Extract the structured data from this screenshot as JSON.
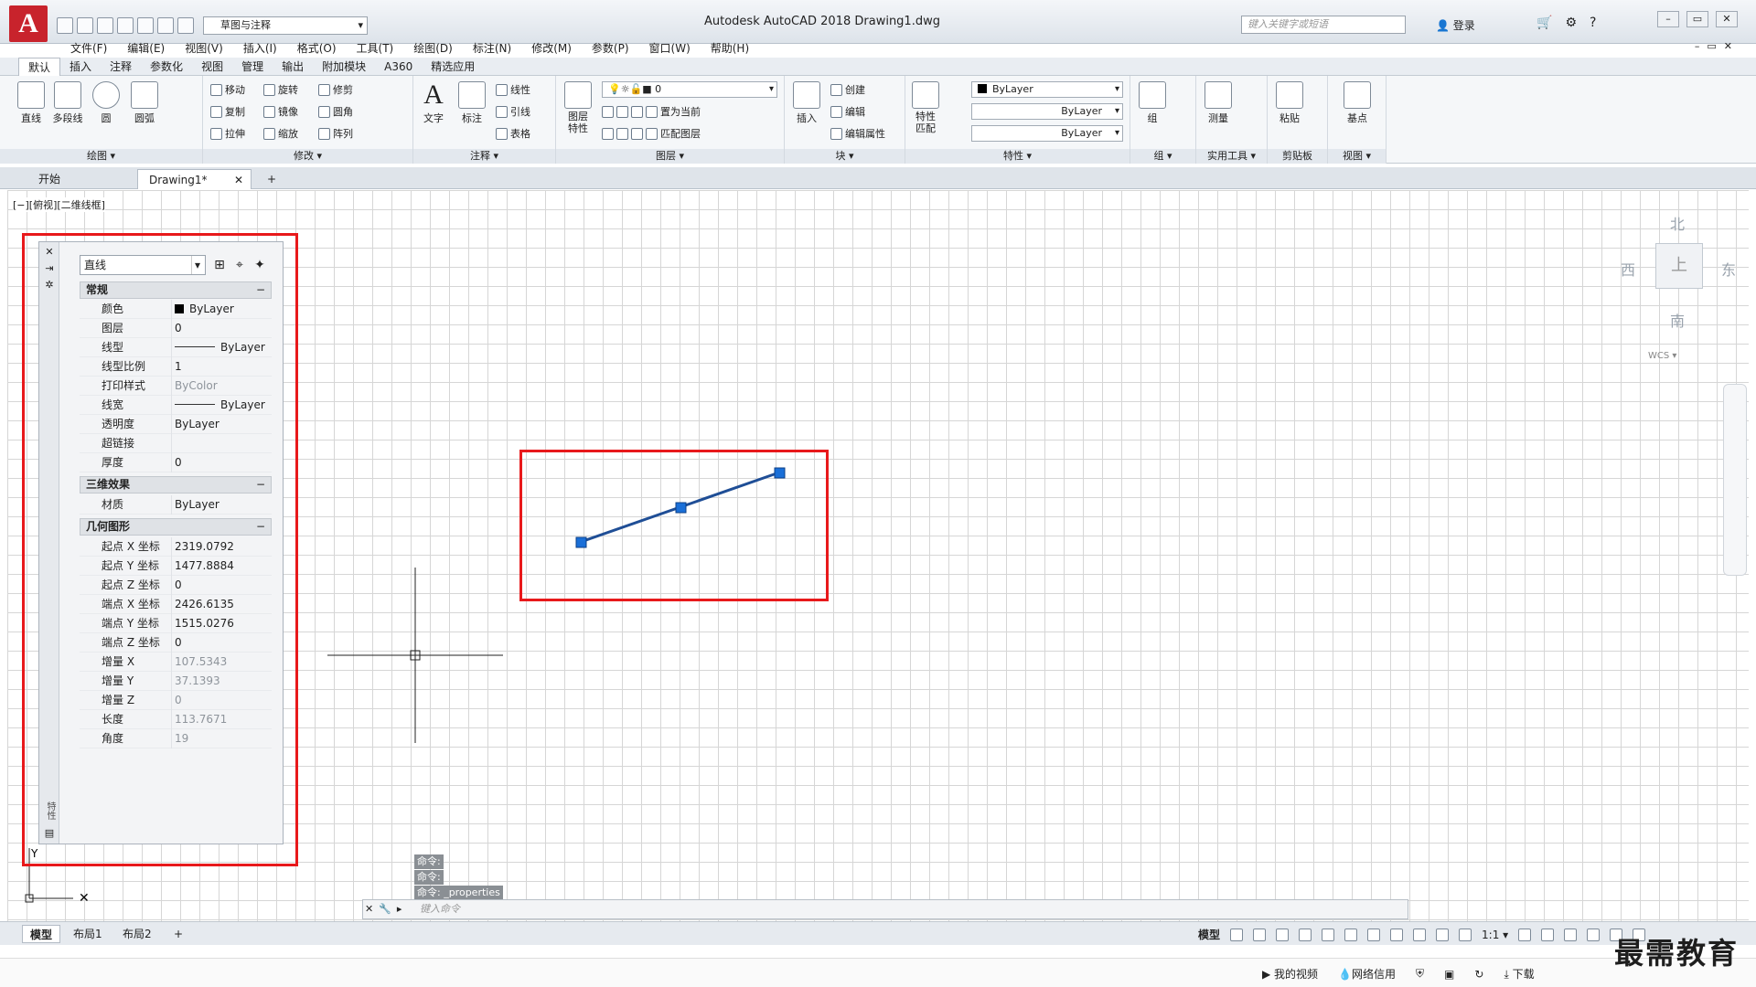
{
  "app": {
    "logo_letter": "A",
    "title": "Autodesk AutoCAD 2018      Drawing1.dwg",
    "workspace": "草图与注释",
    "search_placeholder": "键入关键字或短语",
    "login": "登录"
  },
  "menu": [
    "文件(F)",
    "编辑(E)",
    "视图(V)",
    "插入(I)",
    "格式(O)",
    "工具(T)",
    "绘图(D)",
    "标注(N)",
    "修改(M)",
    "参数(P)",
    "窗口(W)",
    "帮助(H)"
  ],
  "ribbon_tabs": [
    "默认",
    "插入",
    "注释",
    "参数化",
    "视图",
    "管理",
    "输出",
    "附加模块",
    "A360",
    "精选应用"
  ],
  "ribbon": {
    "draw": {
      "label": "绘图 ▾",
      "line": "直线",
      "polyline": "多段线",
      "circle": "圆",
      "arc": "圆弧"
    },
    "modify": {
      "label": "修改 ▾",
      "move": "移动",
      "rotate": "旋转",
      "trim": "修剪",
      "copy": "复制",
      "mirror": "镜像",
      "fillet": "圆角",
      "stretch": "拉伸",
      "scale": "缩放",
      "array": "阵列"
    },
    "annotation": {
      "label": "注释 ▾",
      "text": "文字",
      "dimension": "标注",
      "linear": "线性",
      "leader": "引线",
      "table": "表格"
    },
    "layers": {
      "label": "图层 ▾",
      "layer_props": "图层\n特性",
      "current_layer": "0",
      "set_current": "置为当前",
      "match_layer": "匹配图层"
    },
    "block": {
      "label": "块 ▾",
      "insert": "插入",
      "create": "创建",
      "edit": "编辑",
      "edit_attr": "编辑属性"
    },
    "properties": {
      "label": "特性 ▾",
      "match": "特性\n匹配",
      "color": "ByLayer",
      "linetype": "ByLayer",
      "lineweight": "ByLayer"
    },
    "groups": {
      "label": "组 ▾",
      "group": "组"
    },
    "utilities": {
      "label": "实用工具 ▾",
      "measure": "测量"
    },
    "clipboard": {
      "label": "剪贴板",
      "paste": "粘贴"
    },
    "view": {
      "label": "视图 ▾",
      "base": "基点"
    }
  },
  "doc_tabs": {
    "start": "开始",
    "drawing": "Drawing1*",
    "add": "+"
  },
  "viewport": {
    "label": "[−][俯视][二维线框]",
    "compass": {
      "north": "北",
      "south": "南",
      "east": "东",
      "west": "西",
      "top": "上"
    },
    "wcs": "WCS ▾"
  },
  "properties_palette": {
    "object_type": "直线",
    "side_label": "特性",
    "sections": {
      "general": {
        "title": "常规",
        "rows": [
          {
            "name": "颜色",
            "value": "ByLayer"
          },
          {
            "name": "图层",
            "value": "0"
          },
          {
            "name": "线型",
            "value": "ByLayer"
          },
          {
            "name": "线型比例",
            "value": "1"
          },
          {
            "name": "打印样式",
            "value": "ByColor"
          },
          {
            "name": "线宽",
            "value": "ByLayer"
          },
          {
            "name": "透明度",
            "value": "ByLayer"
          },
          {
            "name": "超链接",
            "value": ""
          },
          {
            "name": "厚度",
            "value": "0"
          }
        ]
      },
      "effects3d": {
        "title": "三维效果",
        "rows": [
          {
            "name": "材质",
            "value": "ByLayer"
          }
        ]
      },
      "geometry": {
        "title": "几何图形",
        "rows": [
          {
            "name": "起点 X 坐标",
            "value": "2319.0792"
          },
          {
            "name": "起点 Y 坐标",
            "value": "1477.8884"
          },
          {
            "name": "起点 Z 坐标",
            "value": "0"
          },
          {
            "name": "端点 X 坐标",
            "value": "2426.6135"
          },
          {
            "name": "端点 Y 坐标",
            "value": "1515.0276"
          },
          {
            "name": "端点 Z 坐标",
            "value": "0"
          },
          {
            "name": "增量 X",
            "value": "107.5343"
          },
          {
            "name": "增量 Y",
            "value": "37.1393"
          },
          {
            "name": "增量 Z",
            "value": "0"
          },
          {
            "name": "长度",
            "value": "113.7671"
          },
          {
            "name": "角度",
            "value": "19"
          }
        ]
      }
    }
  },
  "command": {
    "history": [
      "命令:",
      "命令:",
      "命令: _properties"
    ],
    "placeholder": "键入命令"
  },
  "layout_tabs": [
    "模型",
    "布局1",
    "布局2",
    "+"
  ],
  "status": {
    "model": "模型",
    "scale": "1:1 ▾"
  },
  "taskbar": {
    "my_video": "我的视频",
    "credit": "网络信用",
    "download": "下载"
  },
  "watermark": "最需教育",
  "colors": {
    "highlight_box": "#e8191b",
    "grip": "#1a6fd8",
    "selected_line": "#1f4e96"
  }
}
